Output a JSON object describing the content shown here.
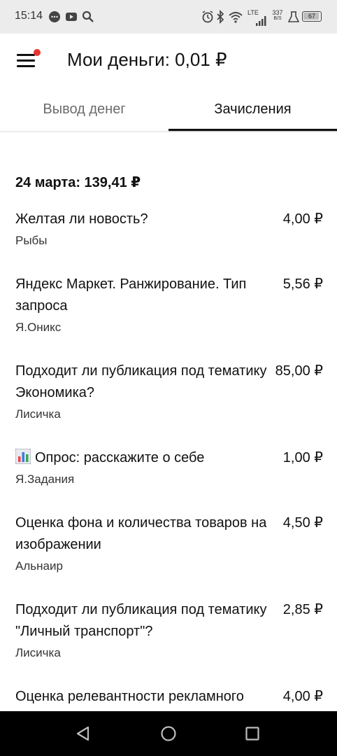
{
  "status_bar": {
    "time": "15:14",
    "left_icons": [
      "chat-bubble-icon",
      "youtube-icon",
      "search-icon"
    ],
    "right_icons": [
      "alarm-icon",
      "bluetooth-icon",
      "wifi-icon",
      "signal-icon",
      "lab-icon",
      "battery-icon"
    ],
    "network_label": "LTE",
    "speed_value": "337",
    "speed_unit": "B/S",
    "battery_level": "67"
  },
  "header": {
    "menu_icon": "hamburger-menu-icon",
    "notification_dot_color": "#e8352e",
    "title": "Мои деньги: 0,01 ₽"
  },
  "tabs": [
    {
      "label": "Вывод денег",
      "active": false
    },
    {
      "label": "Зачисления",
      "active": true
    }
  ],
  "content": {
    "date_header": "24 марта: 139,41 ₽",
    "items": [
      {
        "title": "Желтая ли новость?",
        "amount": "4,00 ₽",
        "requester": "Рыбы"
      },
      {
        "title": "Яндекс Маркет. Ранжирование. Тип запроса",
        "amount": "5,56 ₽",
        "requester": "Я.Оникс"
      },
      {
        "title": "Подходит ли публикация под тематику Экономика?",
        "amount": "85,00 ₽",
        "requester": "Лисичка"
      },
      {
        "title": "Опрос: расскажите о себе",
        "icon": "bar-chart-emoji-icon",
        "amount": "1,00 ₽",
        "requester": "Я.Задания"
      },
      {
        "title": "Оценка фона и количества товаров на изображении",
        "amount": "4,50 ₽",
        "requester": "Альнаир"
      },
      {
        "title": "Подходит ли публикация под тематику \"Личный транспорт\"?",
        "amount": "2,85 ₽",
        "requester": "Лисичка"
      },
      {
        "title": "Оценка релевантности рекламного",
        "amount": "4,00 ₽",
        "requester": ""
      }
    ]
  },
  "nav_bar": {
    "buttons": [
      "back-triangle-icon",
      "home-circle-icon",
      "recents-square-icon"
    ]
  }
}
